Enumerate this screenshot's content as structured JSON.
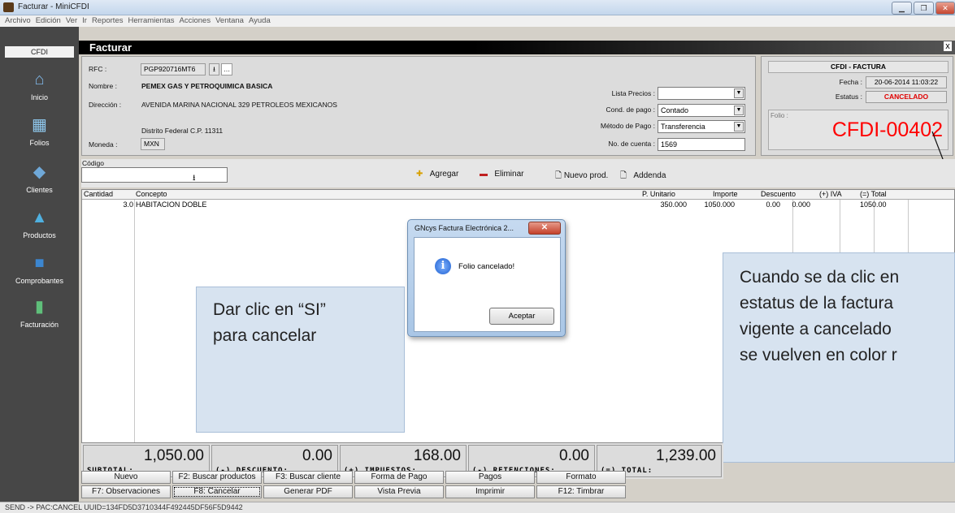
{
  "window": {
    "title": "Facturar - MiniCFDI"
  },
  "menu": [
    "Archivo",
    "Edición",
    "Ver",
    "Ir",
    "Reportes",
    "Herramientas",
    "Acciones",
    "Ventana",
    "Ayuda"
  ],
  "sidebar": {
    "header": "CFDI",
    "items": [
      {
        "label": "Inicio",
        "icon": "home-icon"
      },
      {
        "label": "Folios",
        "icon": "qr-icon"
      },
      {
        "label": "Clientes",
        "icon": "clients-icon"
      },
      {
        "label": "Productos",
        "icon": "products-icon"
      },
      {
        "label": "Comprobantes",
        "icon": "receipts-icon"
      },
      {
        "label": "Facturación",
        "icon": "billing-icon"
      }
    ]
  },
  "form": {
    "title": "Facturar",
    "close": "x"
  },
  "client": {
    "rfc_label": "RFC :",
    "rfc": "PGP920716MT6",
    "nombre_label": "Nombre :",
    "nombre": "PEMEX GAS Y PETROQUIMICA BASICA",
    "direccion_label": "Dirección :",
    "direccion": "AVENIDA MARINA NACIONAL 329 PETROLEOS MEXICANOS",
    "direccion2": "Distrito Federal C.P. 11311",
    "moneda_label": "Moneda :",
    "moneda": "MXN"
  },
  "payment": {
    "lista_label": "Lista Precios :",
    "lista": "",
    "cond_label": "Cond. de pago :",
    "cond": "Contado",
    "metodo_label": "Método de Pago :",
    "metodo": "Transferencia",
    "cuenta_label": "No. de cuenta :",
    "cuenta": "1569"
  },
  "cfdi": {
    "header": "CFDI - FACTURA",
    "fecha_label": "Fecha :",
    "fecha": "20-06-2014 11:03:22",
    "estatus_label": "Estatus :",
    "estatus": "CANCELADO",
    "folio_label": "Folio :",
    "folio": "CFDI-00402",
    "status_color": "#ff0000"
  },
  "toolbar": {
    "codigo_label": "Código",
    "codigo": "",
    "agregar": "Agregar",
    "eliminar": "Eliminar",
    "nuevo_prod": "Nuevo prod.",
    "addenda": "Addenda"
  },
  "grid": {
    "columns": [
      "Cantidad",
      "Concepto",
      "P. Unitario",
      "Importe",
      "Descuento",
      "(+) IVA",
      "(=) Total"
    ],
    "rows": [
      [
        "3.0",
        "HABITACION DOBLE",
        "350.000",
        "1050.000",
        "0.00",
        "0.000",
        "1050.00"
      ]
    ]
  },
  "totals": [
    {
      "value": "1,050.00",
      "label": "SUBTOTAL:"
    },
    {
      "value": "0.00",
      "label": "(-) DESCUENTO:"
    },
    {
      "value": "168.00",
      "label": "(+) IMPUESTOS:"
    },
    {
      "value": "0.00",
      "label": "(-) RETENCIONES:"
    },
    {
      "value": "1,239.00",
      "label": "(=) TOTAL:"
    }
  ],
  "buttons": {
    "row1": [
      "Nuevo",
      "F2: Buscar productos",
      "F3: Buscar cliente",
      "Forma de Pago",
      "Pagos",
      "Formato"
    ],
    "row2": [
      "F7: Observaciones",
      "F8: Cancelar",
      "Generar PDF",
      "Vista Previa",
      "Imprimir",
      "F12: Timbrar"
    ]
  },
  "dialog": {
    "title": "GNcys Factura Electrónica 2...",
    "message": "Folio cancelado!",
    "ok": "Aceptar"
  },
  "callouts": {
    "left": [
      "Dar clic en “SI”",
      "para cancelar"
    ],
    "right": [
      "Cuando se da clic en",
      "estatus de la factura",
      "vigente a cancelado",
      "se vuelven en color r"
    ]
  },
  "status": {
    "text": "SEND -> PAC:CANCEL UUID=134FD5D3710344F492445DF56F5D9442"
  }
}
